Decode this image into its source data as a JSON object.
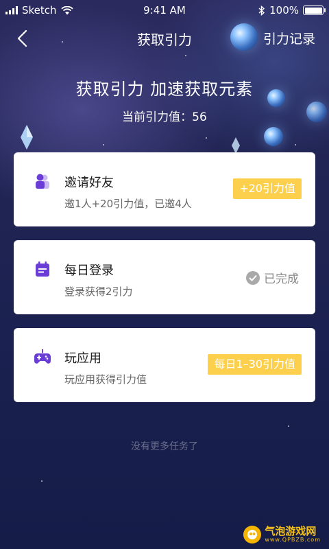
{
  "status_bar": {
    "carrier": "Sketch",
    "time": "9:41 AM",
    "battery": "100%",
    "battery_level": 1.0
  },
  "nav": {
    "title": "获取引力",
    "right_link": "引力记录"
  },
  "hero": {
    "title": "获取引力 加速获取元素",
    "current_value": "当前引力值：56"
  },
  "tasks": [
    {
      "title": "邀请好友",
      "desc": "邀1人+20引力值，已邀4人",
      "action": "+20引力值",
      "icon": "users-icon",
      "action_type": "badge"
    },
    {
      "title": "每日登录",
      "desc": "登录获得2引力",
      "action": "已完成",
      "icon": "calendar-icon",
      "action_type": "completed"
    },
    {
      "title": "玩应用",
      "desc": "玩应用获得引力值",
      "action": "每日1–30引力值",
      "icon": "gamepad-icon",
      "action_type": "badge"
    }
  ],
  "footer": {
    "no_more": "没有更多任务了"
  },
  "watermark": {
    "brand": "气泡游戏网",
    "url": "www.QPBZB.com"
  },
  "colors": {
    "accent_yellow": "#fcd04d",
    "icon_purple": "#6a3ed6",
    "background": "#1b2150"
  }
}
